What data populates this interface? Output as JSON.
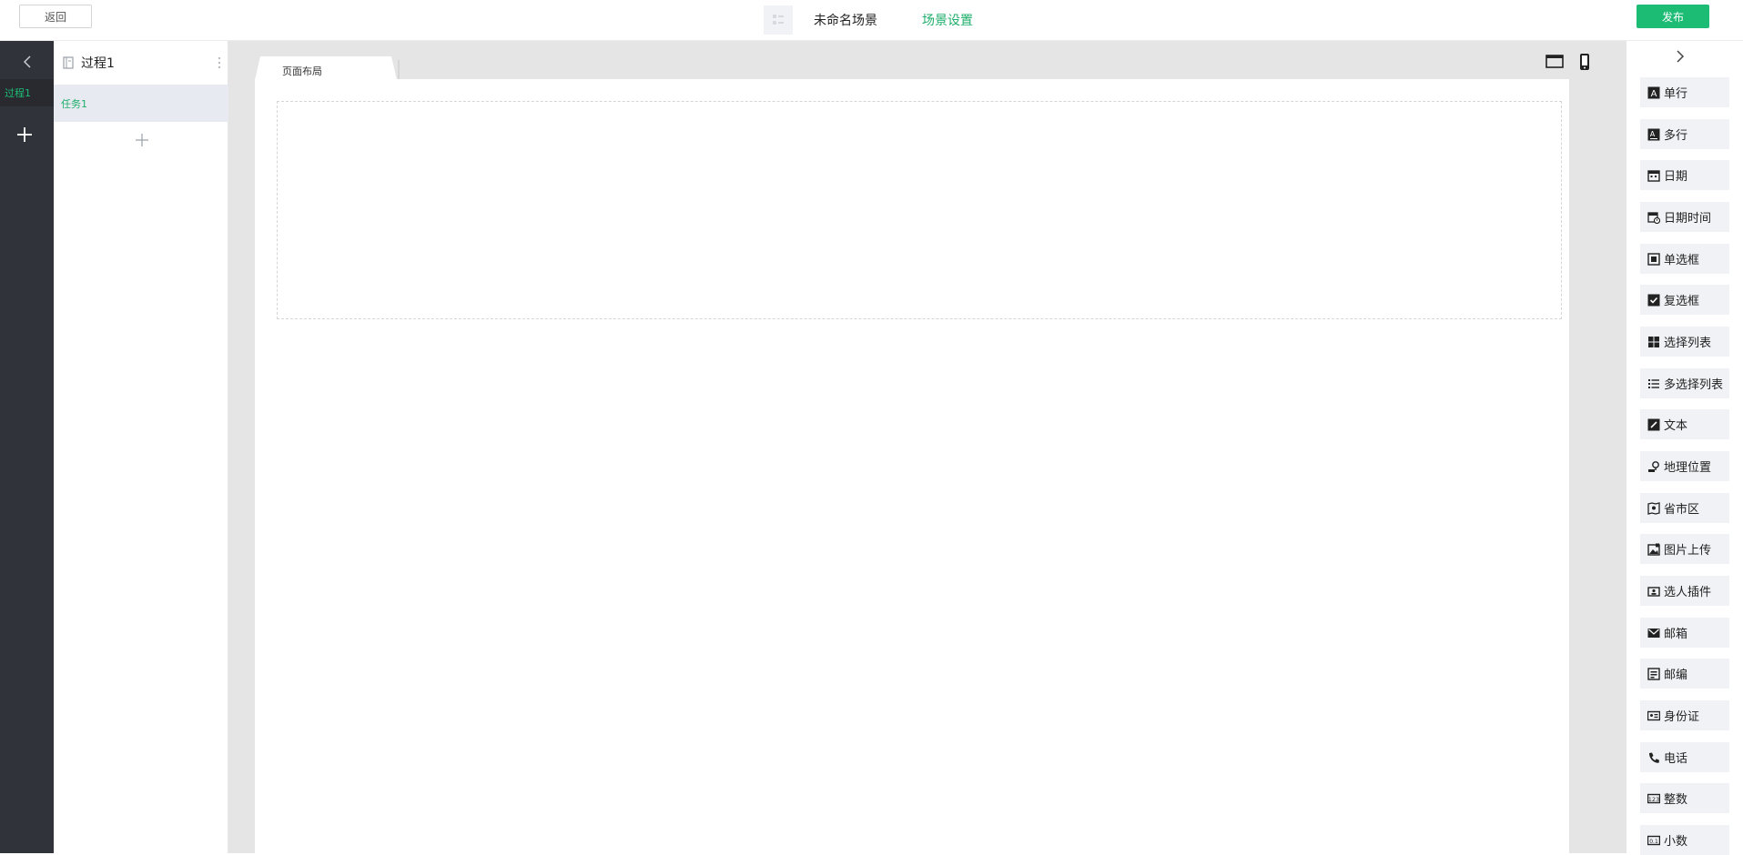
{
  "header": {
    "back_label": "返回",
    "scene_name": "未命名场景",
    "scene_settings_label": "场景设置",
    "publish_label": "发布"
  },
  "rail": {
    "items": [
      {
        "label": "过程1"
      }
    ]
  },
  "process_panel": {
    "title": "过程1",
    "tasks": [
      {
        "label": "任务1"
      }
    ]
  },
  "canvas": {
    "tab_label": "页面布局"
  },
  "components": [
    {
      "label": "单行",
      "icon": "text-single-line-icon"
    },
    {
      "label": "多行",
      "icon": "text-multi-line-icon"
    },
    {
      "label": "日期",
      "icon": "calendar-icon"
    },
    {
      "label": "日期时间",
      "icon": "calendar-clock-icon"
    },
    {
      "label": "单选框",
      "icon": "radio-icon"
    },
    {
      "label": "复选框",
      "icon": "checkbox-icon"
    },
    {
      "label": "选择列表",
      "icon": "grid-icon"
    },
    {
      "label": "多选择列表",
      "icon": "list-icon"
    },
    {
      "label": "文本",
      "icon": "edit-icon"
    },
    {
      "label": "地理位置",
      "icon": "location-icon"
    },
    {
      "label": "省市区",
      "icon": "map-icon"
    },
    {
      "label": "图片上传",
      "icon": "image-upload-icon"
    },
    {
      "label": "选人插件",
      "icon": "person-picker-icon"
    },
    {
      "label": "邮箱",
      "icon": "mail-icon"
    },
    {
      "label": "邮编",
      "icon": "postcode-icon"
    },
    {
      "label": "身份证",
      "icon": "id-card-icon"
    },
    {
      "label": "电话",
      "icon": "phone-icon"
    },
    {
      "label": "整数",
      "icon": "integer-icon"
    },
    {
      "label": "小数",
      "icon": "decimal-icon"
    }
  ],
  "colors": {
    "accent": "#1dbc75",
    "rail": "#31333a",
    "canvas": "#e5e5e5"
  }
}
